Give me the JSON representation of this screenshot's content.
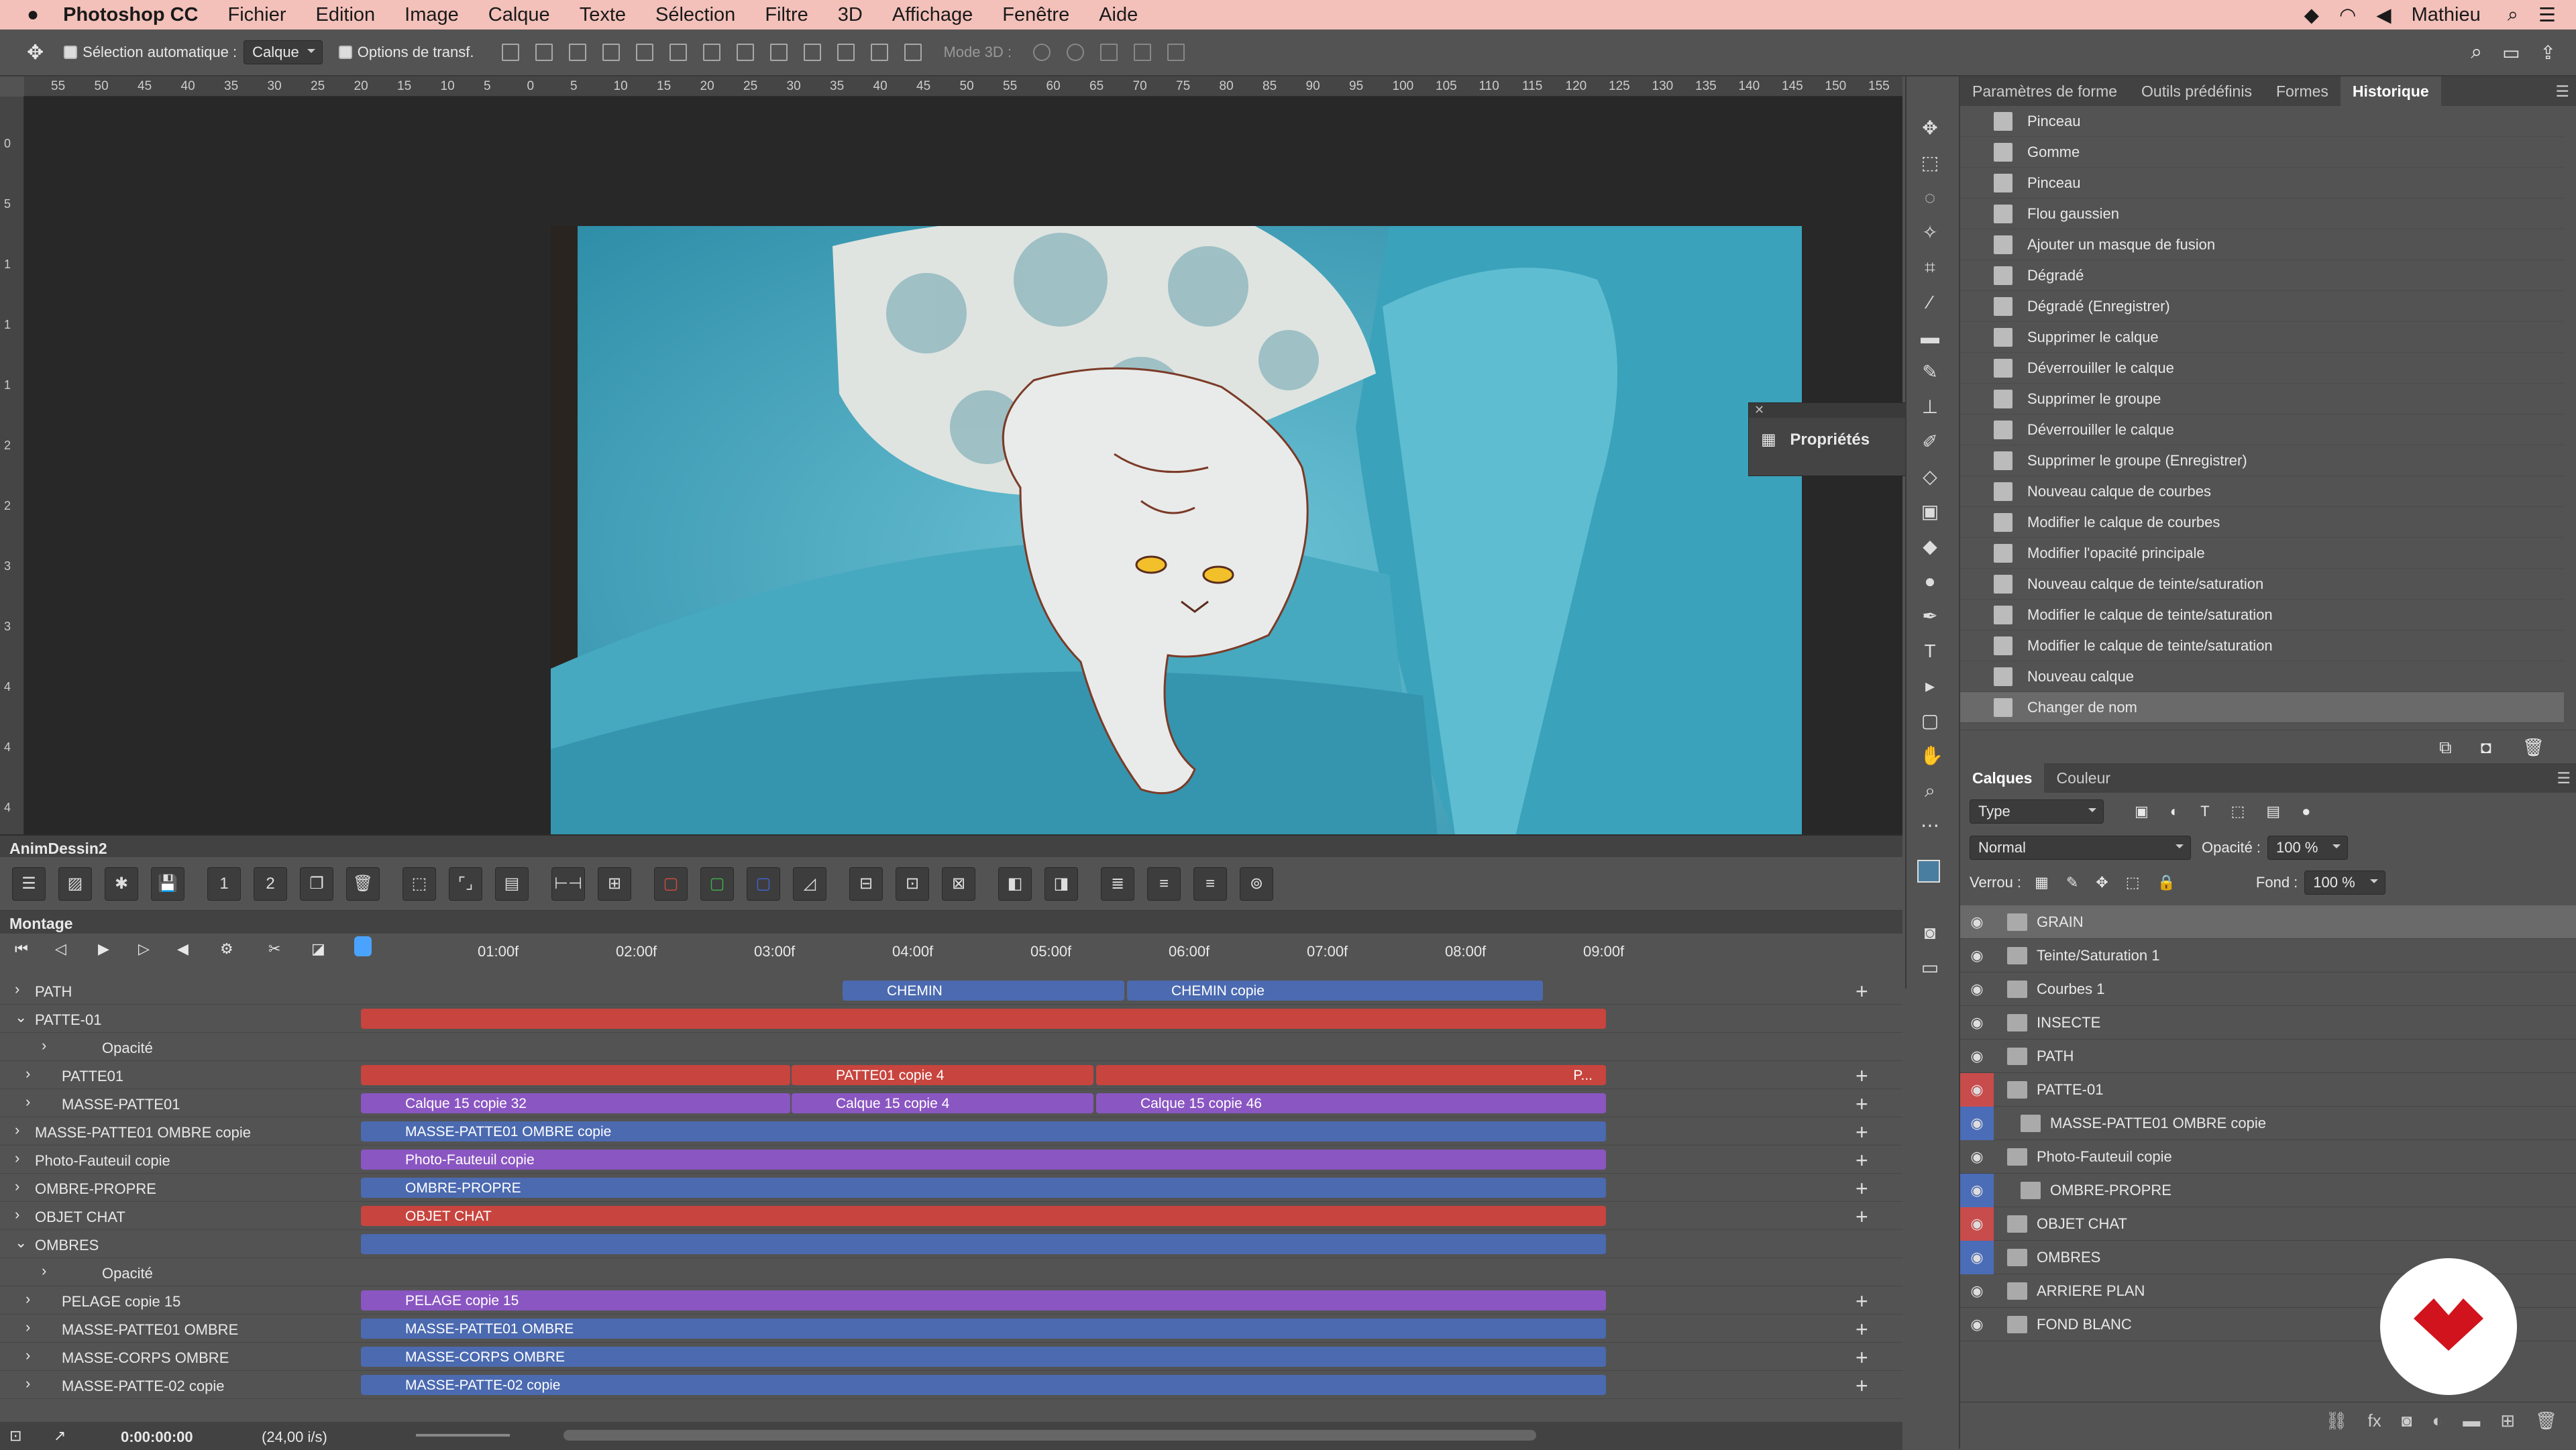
{
  "macbar": {
    "app": "Photoshop CC",
    "menus": [
      "Fichier",
      "Edition",
      "Image",
      "Calque",
      "Texte",
      "Sélection",
      "Filtre",
      "3D",
      "Affichage",
      "Fenêtre",
      "Aide"
    ],
    "user": "Mathieu"
  },
  "options": {
    "auto_select": "Sélection automatique :",
    "auto_select_value": "Calque",
    "transform": "Options de transf.",
    "mode3d": "Mode 3D :"
  },
  "ruler_top": [
    "55",
    "50",
    "45",
    "40",
    "35",
    "30",
    "25",
    "20",
    "15",
    "10",
    "5",
    "0",
    "5",
    "10",
    "15",
    "20",
    "25",
    "30",
    "35",
    "40",
    "45",
    "50",
    "55",
    "60",
    "65",
    "70",
    "75",
    "80",
    "85",
    "90",
    "95",
    "100",
    "105",
    "110",
    "115",
    "120",
    "125",
    "130",
    "135",
    "140",
    "145",
    "150",
    "155"
  ],
  "ruler_left": [
    "0",
    "5",
    "1",
    "1",
    "1",
    "2",
    "2",
    "3",
    "3",
    "4",
    "4",
    "4"
  ],
  "props": {
    "title": "Propriétés"
  },
  "panels": {
    "tabs": [
      "Paramètres de forme",
      "Outils prédéfinis",
      "Formes",
      "Historique"
    ],
    "history": [
      "Pinceau",
      "Gomme",
      "Pinceau",
      "Flou gaussien",
      "Ajouter un masque de fusion",
      "Dégradé",
      "Dégradé (Enregistrer)",
      "Supprimer le calque",
      "Déverrouiller le calque",
      "Supprimer le groupe",
      "Déverrouiller le calque",
      "Supprimer le groupe (Enregistrer)",
      "Nouveau calque de courbes",
      "Modifier le calque de courbes",
      "Modifier l'opacité principale",
      "Nouveau calque de teinte/saturation",
      "Modifier le calque de teinte/saturation",
      "Modifier le calque de teinte/saturation",
      "Nouveau calque",
      "Changer de nom"
    ],
    "layer_tabs": [
      "Calques",
      "Couleur"
    ],
    "filter": "Type",
    "blend": "Normal",
    "opacity_label": "Opacité :",
    "opacity": "100 %",
    "lock_label": "Verrou :",
    "fill_label": "Fond :",
    "fill": "100 %",
    "layers": [
      "GRAIN",
      "Teinte/Saturation 1",
      "Courbes 1",
      "INSECTE",
      "PATH",
      "PATTE-01",
      "MASSE-PATTE01 OMBRE copie",
      "Photo-Fauteuil copie",
      "OMBRE-PROPRE",
      "OBJET CHAT",
      "OMBRES",
      "ARRIERE PLAN",
      "FOND BLANC"
    ]
  },
  "timeline": {
    "doc": "AnimDessin2",
    "title": "Montage",
    "times": [
      "01:00f",
      "02:00f",
      "03:00f",
      "04:00f",
      "05:00f",
      "06:00f",
      "07:00f",
      "08:00f",
      "09:00f"
    ],
    "rows": [
      "PATH",
      "PATTE-01",
      "Opacité",
      "PATTE01",
      "MASSE-PATTE01",
      "MASSE-PATTE01 OMBRE copie",
      "Photo-Fauteuil copie",
      "OMBRE-PROPRE",
      "OBJET CHAT",
      "OMBRES",
      "Opacité",
      "PELAGE copie 15",
      "MASSE-PATTE01 OMBRE",
      "MASSE-CORPS OMBRE",
      "MASSE-PATTE-02 copie"
    ],
    "clips": {
      "path1": "CHEMIN",
      "path2": "CHEMIN copie",
      "patte01": "PATTE01 copie 4",
      "patte01b": "P...",
      "masse1": "Calque 15 copie 32",
      "masse2": "Calque 15 copie 4",
      "masse3": "Calque 15 copie 46",
      "ombre_copie": "MASSE-PATTE01 OMBRE copie",
      "photo": "Photo-Fauteuil copie",
      "ombre_propre": "OMBRE-PROPRE",
      "chat": "OBJET CHAT",
      "pelage": "PELAGE copie 15",
      "masse_ombre": "MASSE-PATTE01 OMBRE",
      "corps": "MASSE-CORPS OMBRE",
      "patte02": "MASSE-PATTE-02 copie"
    },
    "timecode": "0:00:00:00",
    "fps": "(24,00 i/s)"
  },
  "colors": {
    "red": "#c8443e",
    "blue": "#4b6ab0",
    "purple": "#8a56c2",
    "chair": "#4fb0c6"
  }
}
